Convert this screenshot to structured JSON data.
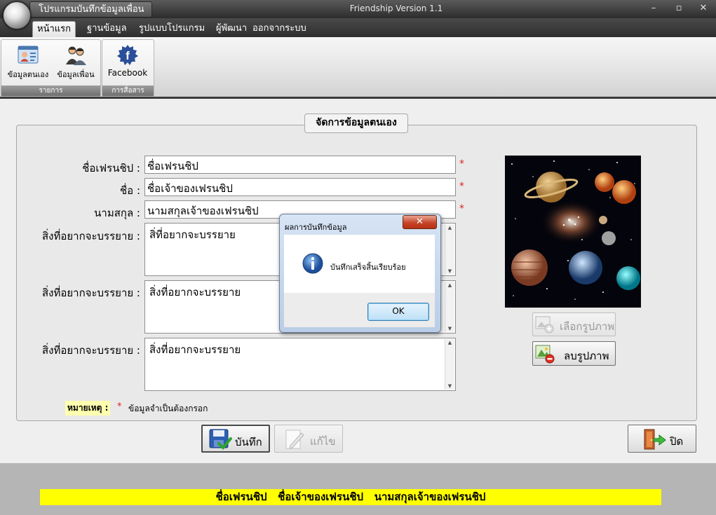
{
  "window": {
    "app_title": "โปรแกรมบันทึกข้อมูลเพื่อน",
    "version": "Friendship Version 1.1",
    "minimize": "–",
    "maximize": "▫",
    "close": "✕"
  },
  "menu": {
    "tabs": [
      "หน้าแรก",
      "ฐานข้อมูล",
      "รูปแบบโปรแกรม",
      "ผู้พัฒนา",
      "ออกจากระบบ"
    ]
  },
  "ribbon": {
    "groups": [
      {
        "label": "รายการ",
        "buttons": [
          {
            "label": "ข้อมูลตนเอง",
            "icon": "profile-card-icon"
          },
          {
            "label": "ข้อมูลเพื่อน",
            "icon": "friends-icon"
          }
        ]
      },
      {
        "label": "การสื่อสาร",
        "buttons": [
          {
            "label": "Facebook",
            "icon": "facebook-icon"
          }
        ]
      }
    ]
  },
  "form": {
    "title": "จัดการข้อมูลตนเอง",
    "fields": [
      {
        "label": "ชื่อเฟรนชิป :",
        "value": "ชื่อเฟรนชิป",
        "required": "*"
      },
      {
        "label": "ชื่อ :",
        "value": "ชื่อเจ้าของเฟรนชิป",
        "required": "*"
      },
      {
        "label": "นามสกุล :",
        "value": "นามสกุลเจ้าของเฟรนชิป",
        "required": "*"
      }
    ],
    "descriptions": [
      {
        "label": "สิ่งที่อยากจะบรรยาย :",
        "value": "สิ่ที่อยากจะบรรยาย"
      },
      {
        "label": "สิ่งที่อยากจะบรรยาย :",
        "value": "สิ่งที่อยากจะบรรยาย"
      },
      {
        "label": "สิ่งที่อยากจะบรรยาย :",
        "value": "สิ่งที่อยากจะบรรยาย"
      }
    ],
    "note_label": "หมายเหตุ :",
    "note_star": "*",
    "note_text": "ข้อมูลจำเป็นต้องกรอก",
    "choose_photo": "เลือกรูปภาพ",
    "delete_photo": "ลบรูปภาพ",
    "save": "บันทึก",
    "edit": "แก้ไข",
    "close": "ปิด"
  },
  "status": {
    "text": "ชื่อเฟรนชิป   ชื่อเจ้าของเฟรนชิป   นามสกุลเจ้าของเฟรนชิป"
  },
  "dialog": {
    "title": "ผลการบันทึกข้อมูล",
    "message": "บันทึกเสร็จสิ้นเรียบร้อย",
    "ok": "OK",
    "close": "✕",
    "icon": "info-icon"
  },
  "colors": {
    "title_bar": "#2c2c2c",
    "status_highlight": "#ffff00",
    "required": "#dd2222",
    "dialog_frame": "#b9cde6"
  }
}
